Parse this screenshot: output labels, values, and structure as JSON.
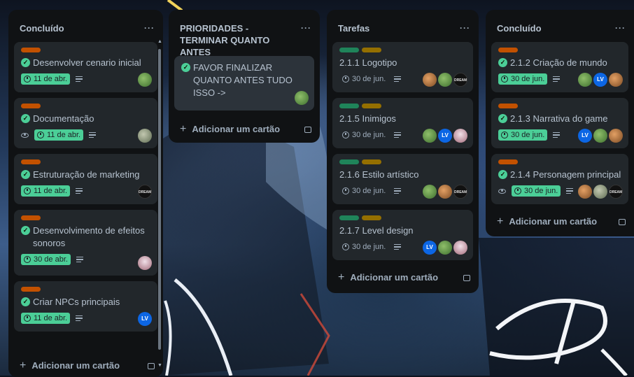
{
  "colors": {
    "list_bg": "#101204",
    "card_bg": "#22272b",
    "done_green": "#4bce97",
    "label_orange": "#c25100",
    "label_green": "#1f845a",
    "label_yellow": "#946f00"
  },
  "add_card_label": "Adicionar um cartão",
  "list_menu": "···",
  "lists": [
    {
      "title": "Concluído",
      "cards": [
        {
          "labels": [
            "orange"
          ],
          "title": "Desenvolver cenario inicial",
          "done": true,
          "date": "11 de abr.",
          "date_done": true,
          "desc": true,
          "members": [
            "g1"
          ]
        },
        {
          "labels": [
            "orange"
          ],
          "title": "Documentação",
          "done": true,
          "watch": true,
          "date": "11 de abr.",
          "date_done": true,
          "desc": true,
          "members": [
            "g2"
          ]
        },
        {
          "labels": [
            "orange"
          ],
          "title": "Estruturação de marketing",
          "done": true,
          "date": "11 de abr.",
          "date_done": true,
          "desc": true,
          "members": [
            "dream"
          ]
        },
        {
          "labels": [
            "orange"
          ],
          "title": "Desenvolvimento de efeitos sonoros",
          "done": true,
          "date": "30 de abr.",
          "date_done": true,
          "desc": true,
          "members": [
            "pink"
          ]
        },
        {
          "labels": [
            "orange"
          ],
          "title": "Criar NPCs principais",
          "done": true,
          "date": "11 de abr.",
          "date_done": true,
          "desc": true,
          "members": [
            "lv"
          ]
        }
      ]
    },
    {
      "title": "PRIORIDADES - TERMINAR QUANTO ANTES",
      "cards": [
        {
          "title": "FAVOR FINALIZAR QUANTO ANTES TUDO ISSO ->",
          "done": true,
          "members": [
            "g1"
          ]
        }
      ]
    },
    {
      "title": "Tarefas",
      "cards": [
        {
          "labels": [
            "green",
            "yellow"
          ],
          "title": "2.1.1 Logotipo",
          "date": "30 de jun.",
          "desc": true,
          "members": [
            "g3",
            "g1",
            "dream"
          ]
        },
        {
          "labels": [
            "green",
            "yellow"
          ],
          "title": "2.1.5 Inimigos",
          "date": "30 de jun.",
          "desc": true,
          "members": [
            "g1",
            "lv",
            "pink"
          ]
        },
        {
          "labels": [
            "green",
            "yellow"
          ],
          "title": "2.1.6 Estilo artístico",
          "date": "30 de jun.",
          "desc": true,
          "members": [
            "g1",
            "g3",
            "dream"
          ]
        },
        {
          "labels": [
            "green",
            "yellow"
          ],
          "title": "2.1.7 Level design",
          "date": "30 de jun.",
          "desc": true,
          "members": [
            "lv",
            "g1",
            "pink"
          ]
        }
      ]
    },
    {
      "title": "Concluído",
      "cards": [
        {
          "labels": [
            "orange"
          ],
          "title": "2.1.2 Criação de mundo",
          "done": true,
          "date": "30 de jun.",
          "date_done": true,
          "desc": true,
          "members": [
            "g1",
            "lv",
            "g3"
          ]
        },
        {
          "labels": [
            "orange"
          ],
          "title": "2.1.3 Narrativa do game",
          "done": true,
          "date": "30 de jun.",
          "date_done": true,
          "desc": true,
          "members": [
            "lv",
            "g1",
            "g3"
          ]
        },
        {
          "labels": [
            "orange"
          ],
          "title": "2.1.4 Personagem principal",
          "done": true,
          "watch": true,
          "date": "30 de jun.",
          "date_done": true,
          "desc": true,
          "members": [
            "g3",
            "g2",
            "dream"
          ]
        }
      ]
    }
  ],
  "avatar_text": {
    "lv": "LV",
    "dream": "DREAM"
  }
}
